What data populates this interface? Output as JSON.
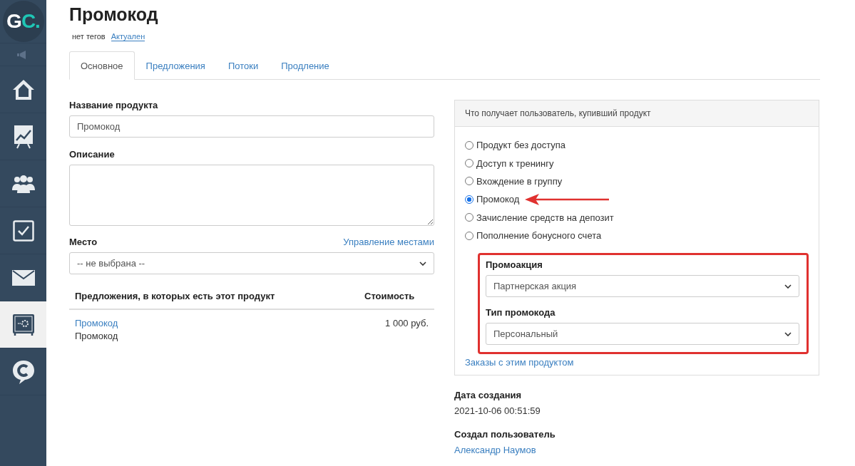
{
  "sidebar": {
    "logo": "GC.",
    "items": [
      {
        "kind": "speaker",
        "selected": false
      },
      {
        "kind": "home",
        "selected": false
      },
      {
        "kind": "chart",
        "selected": false
      },
      {
        "kind": "people",
        "selected": false
      },
      {
        "kind": "check",
        "selected": false
      },
      {
        "kind": "mail",
        "selected": false
      },
      {
        "kind": "safe",
        "selected": true
      },
      {
        "kind": "chat",
        "selected": false
      }
    ]
  },
  "page": {
    "title": "Промокод",
    "tags": "нет тегов",
    "status": "Актуален"
  },
  "tabs": [
    {
      "label": "Основное",
      "selected": true
    },
    {
      "label": "Предложения",
      "selected": false
    },
    {
      "label": "Потоки",
      "selected": false
    },
    {
      "label": "Продление",
      "selected": false
    }
  ],
  "form": {
    "name_label": "Название продукта",
    "name_value": "Промокод",
    "description_label": "Описание",
    "place_label": "Место",
    "place_link": "Управление местами",
    "place_value": "-- не выбрана --"
  },
  "offers": {
    "columns": [
      "Предложения, в которых есть этот продукт",
      "Стоимость"
    ],
    "rows": [
      {
        "link": "Промокод",
        "name": "Промокод",
        "price": "1 000 руб."
      }
    ]
  },
  "access": {
    "heading": "Что получает пользователь, купивший продукт",
    "options": [
      {
        "label": "Продукт без доступа",
        "selected": false
      },
      {
        "label": "Доступ к тренингу",
        "selected": false
      },
      {
        "label": "Вхождение в группу",
        "selected": false
      },
      {
        "label": "Промокод",
        "selected": true
      },
      {
        "label": "Зачисление средств на депозит",
        "selected": false
      },
      {
        "label": "Пополнение бонусного счета",
        "selected": false
      }
    ],
    "fields": [
      {
        "label": "Промоакция",
        "value": "Партнерская акция"
      },
      {
        "label": "Тип промокода",
        "value": "Персональный"
      }
    ],
    "orders_link": "Заказы с этим продуктом"
  },
  "meta": [
    {
      "label": "Дата создания",
      "value": "2021-10-06 00:51:59",
      "kind": "text"
    },
    {
      "label": "Создал пользователь",
      "value": "Александр Наумов",
      "kind": "link"
    }
  ]
}
